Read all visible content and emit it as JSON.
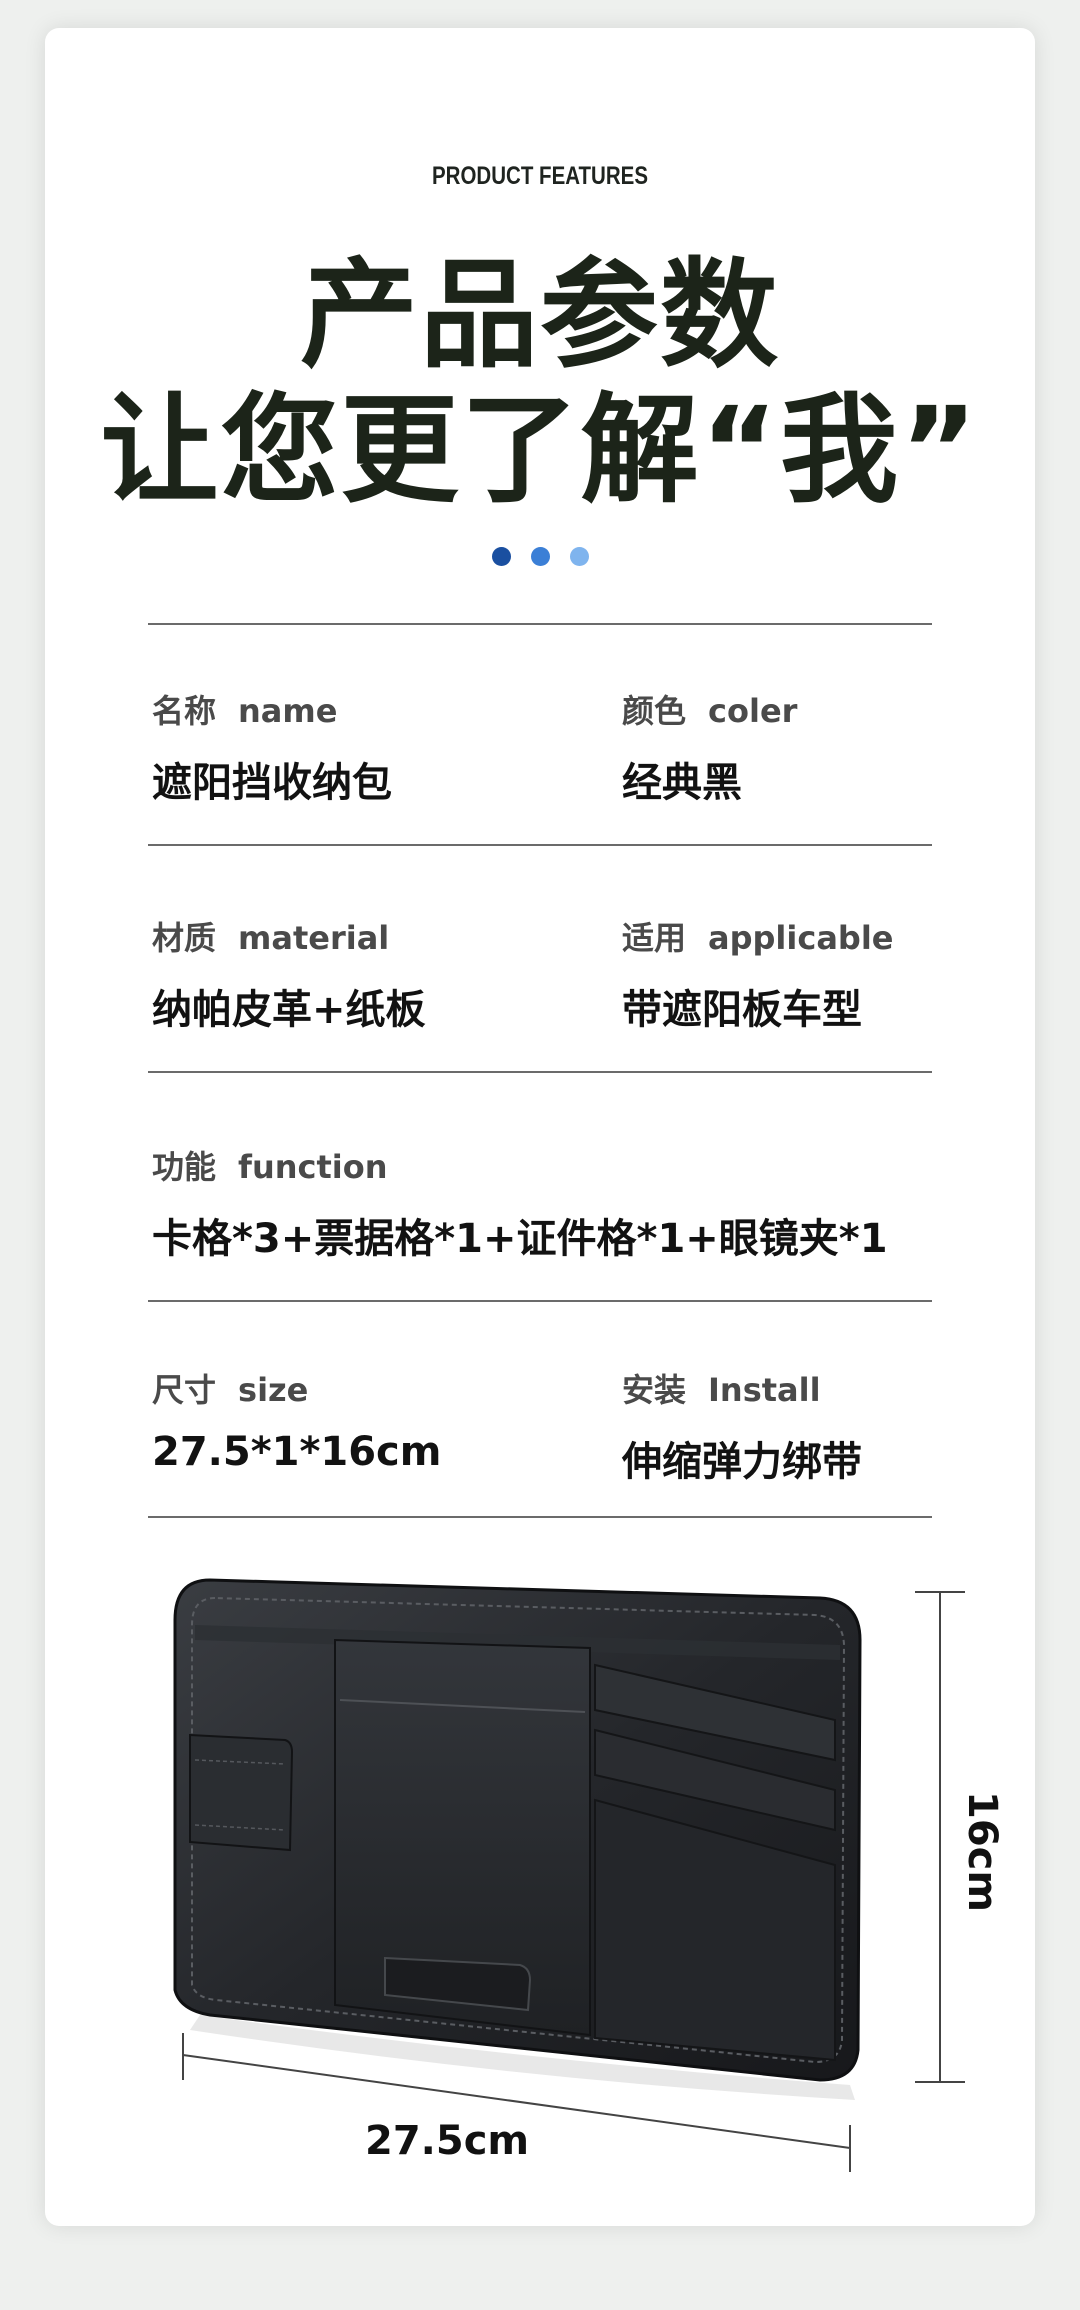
{
  "header": {
    "eyebrow": "PRODUCT FEATURES",
    "title_line1": "产品参数",
    "title_line2": "让您更了解“我”"
  },
  "dots": [
    "#1a4fa0",
    "#3b7fd6",
    "#7fb4ee"
  ],
  "specs": {
    "name": {
      "label_cn": "名称",
      "label_en": "name",
      "value": "遮阳挡收纳包"
    },
    "color": {
      "label_cn": "颜色",
      "label_en": "coler",
      "value": "经典黑"
    },
    "material": {
      "label_cn": "材质",
      "label_en": "material",
      "value": "纳帕皮革+纸板"
    },
    "applicable": {
      "label_cn": "适用",
      "label_en": "applicable",
      "value": "带遮阳板车型"
    },
    "function": {
      "label_cn": "功能",
      "label_en": "function",
      "value": "卡格*3+票据格*1+证件格*1+眼镜夹*1"
    },
    "size": {
      "label_cn": "尺寸",
      "label_en": "size",
      "value": "27.5*1*16cm"
    },
    "install": {
      "label_cn": "安装",
      "label_en": "Install",
      "value": "伸缩弹力绑带"
    }
  },
  "dimensions": {
    "width_label": "27.5cm",
    "height_label": "16cm"
  }
}
